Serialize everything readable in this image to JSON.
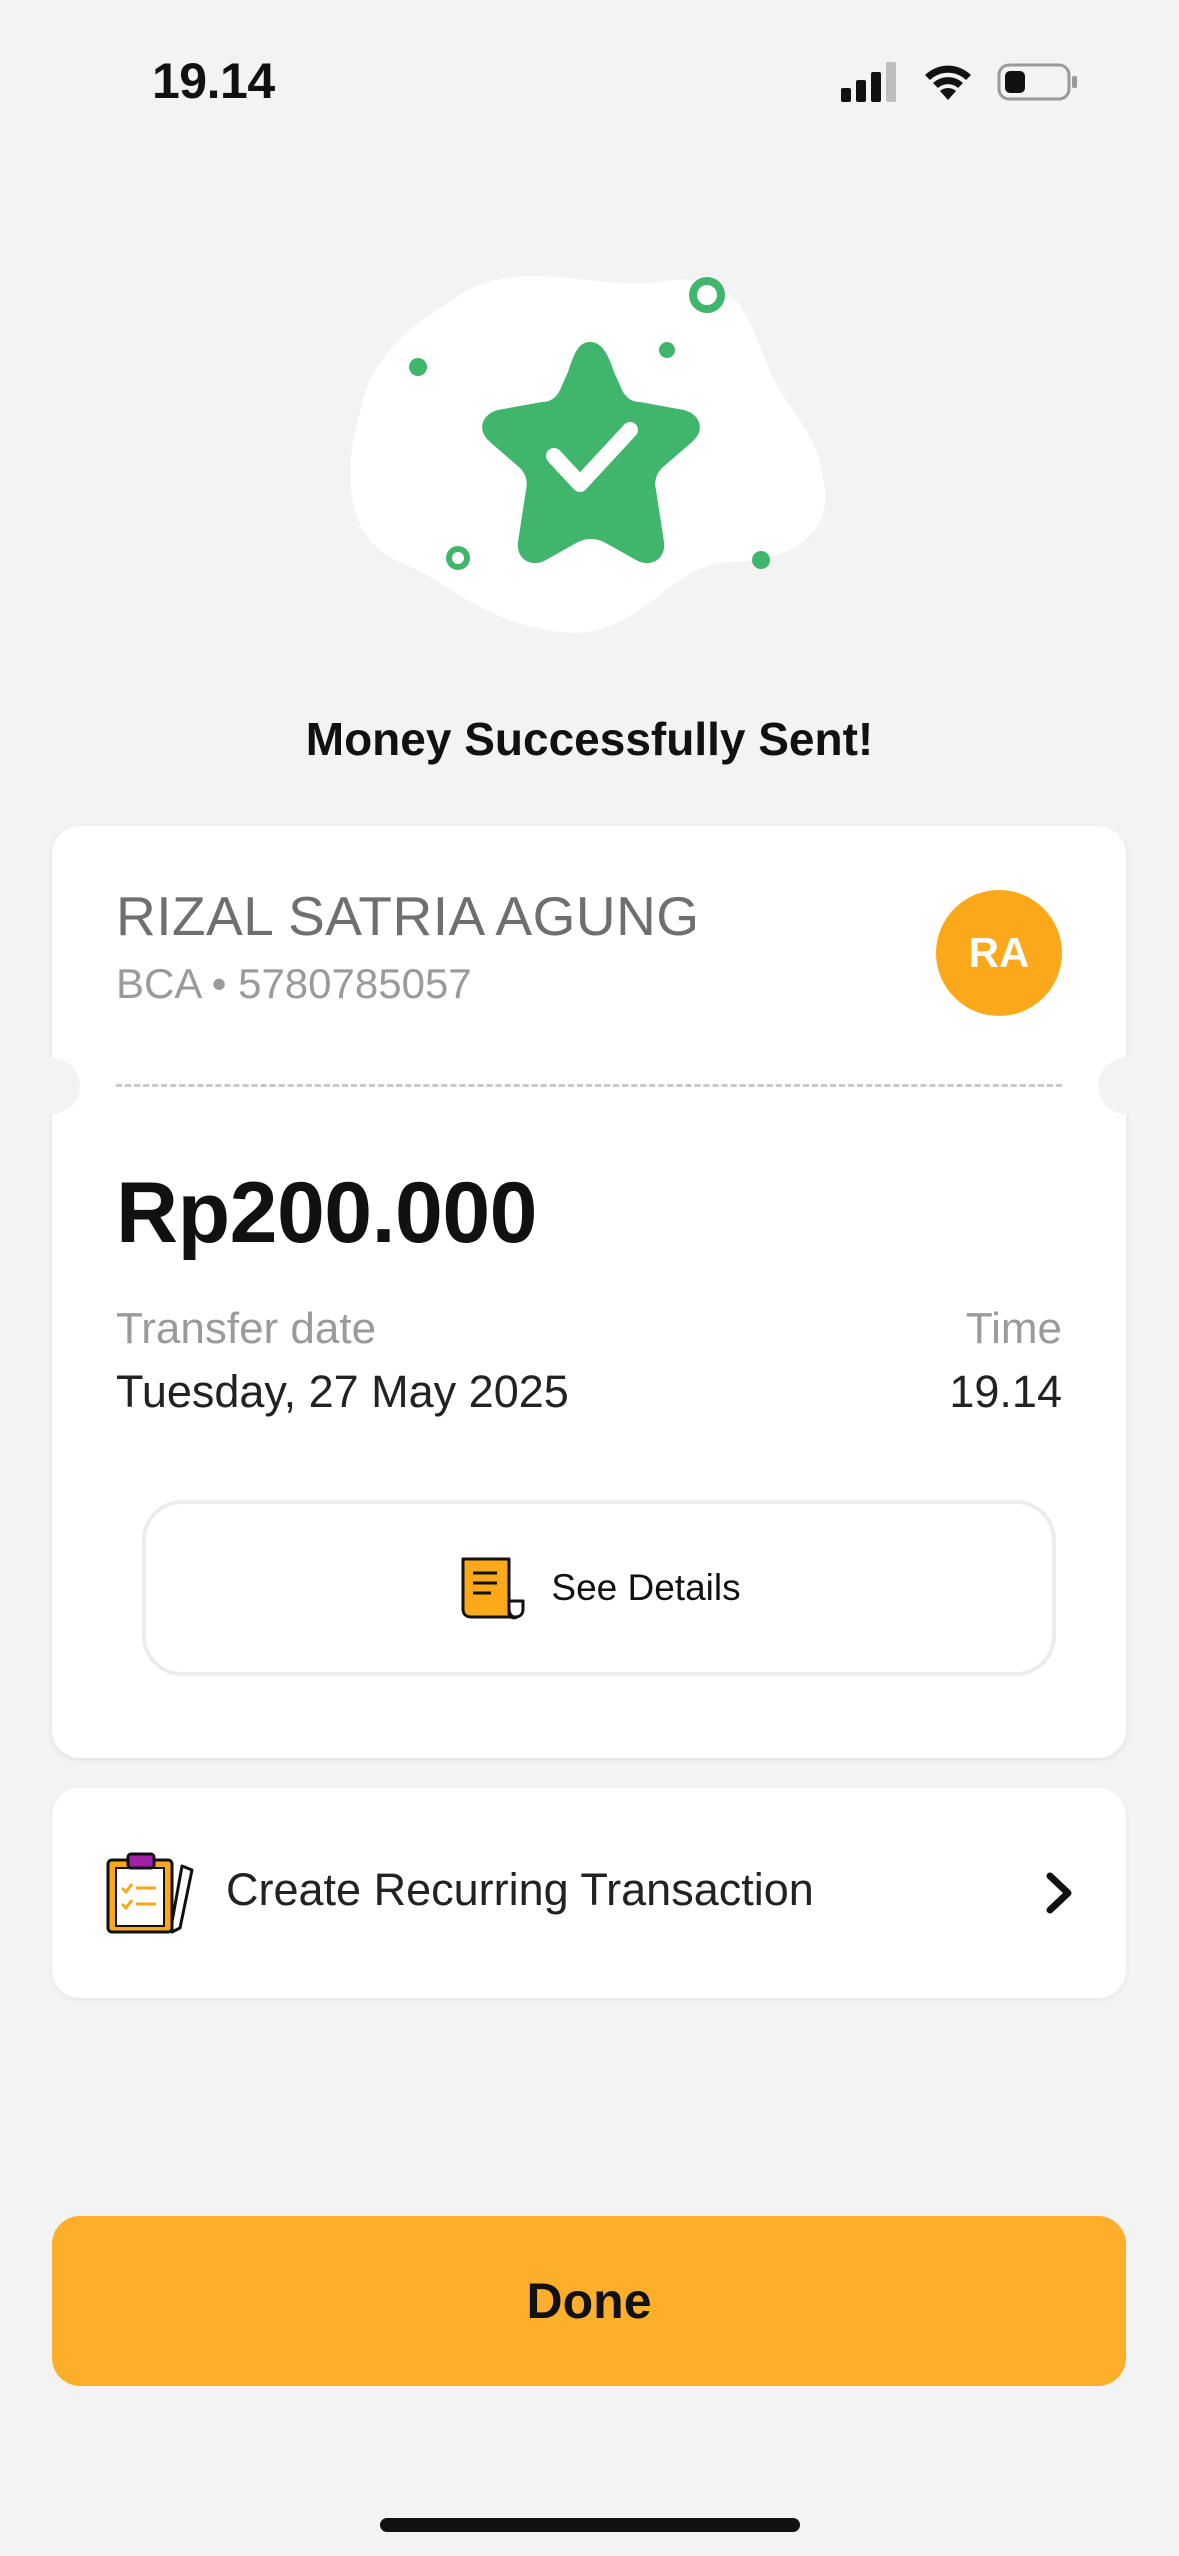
{
  "status_bar": {
    "time": "19.14"
  },
  "headline": "Money Successfully Sent!",
  "recipient": {
    "name": "RIZAL SATRIA AGUNG",
    "bank_account": "BCA • 5780785057",
    "initials": "RA"
  },
  "transfer": {
    "amount": "Rp200.000",
    "date_label": "Transfer date",
    "date_value": "Tuesday, 27 May 2025",
    "time_label": "Time",
    "time_value": "19.14"
  },
  "actions": {
    "see_details": "See Details",
    "recurring": "Create Recurring Transaction",
    "done": "Done"
  },
  "colors": {
    "accent": "#fdae2b",
    "avatar": "#fba91a",
    "success": "#3fb66b",
    "background": "#f3f3f3"
  },
  "icons": [
    "cellular-signal-icon",
    "wifi-icon",
    "battery-icon",
    "success-star-icon",
    "receipt-icon",
    "clipboard-icon",
    "chevron-right-icon"
  ]
}
